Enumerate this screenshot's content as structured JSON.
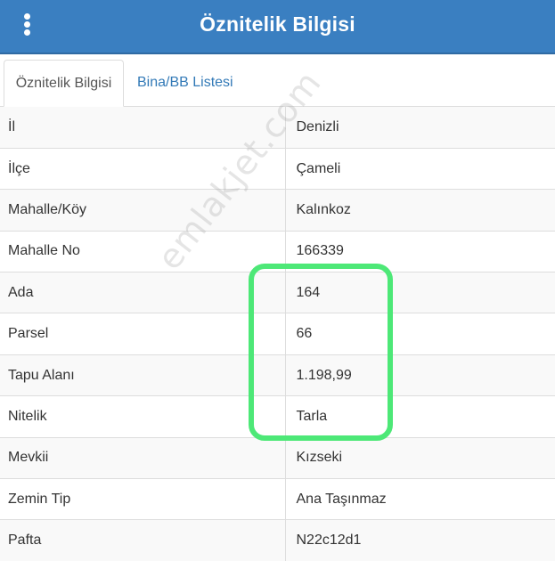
{
  "header": {
    "title": "Öznitelik Bilgisi",
    "menu_icon": "vertical-ellipsis-icon",
    "background_color": "#3a7fc1"
  },
  "tabs": [
    {
      "label": "Öznitelik Bilgisi",
      "active": true
    },
    {
      "label": "Bina/BB Listesi",
      "active": false
    }
  ],
  "attributes": [
    {
      "key": "İl",
      "value": "Denizli"
    },
    {
      "key": "İlçe",
      "value": "Çameli"
    },
    {
      "key": "Mahalle/Köy",
      "value": "Kalınkoz"
    },
    {
      "key": "Mahalle No",
      "value": "166339"
    },
    {
      "key": "Ada",
      "value": "164"
    },
    {
      "key": "Parsel",
      "value": "66"
    },
    {
      "key": "Tapu Alanı",
      "value": "1.198,99"
    },
    {
      "key": "Nitelik",
      "value": "Tarla"
    },
    {
      "key": "Mevkii",
      "value": "Kızseki"
    },
    {
      "key": "Zemin Tip",
      "value": "Ana Taşınmaz"
    },
    {
      "key": "Pafta",
      "value": "N22c12d1"
    }
  ],
  "highlight_color": "#4de877",
  "watermark": "emlakjet.com"
}
